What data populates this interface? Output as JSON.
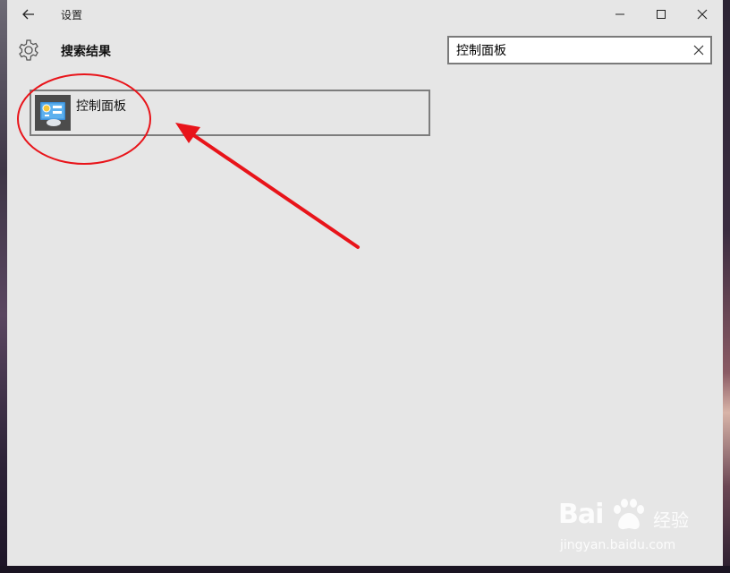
{
  "window": {
    "title": "设置",
    "back_icon": "back-arrow-icon",
    "minimize_icon": "minimize-icon",
    "maximize_icon": "maximize-icon",
    "close_icon": "close-icon"
  },
  "header": {
    "icon": "gear-icon",
    "title": "搜索结果"
  },
  "search": {
    "value": "控制面板",
    "clear_icon": "clear-x-icon"
  },
  "results": [
    {
      "label": "控制面板",
      "icon": "control-panel-icon"
    }
  ],
  "annotations": {
    "color": "#e8141a",
    "circle": "highlight-circle",
    "arrow": "pointer-arrow"
  },
  "watermark": {
    "brand": "Bai",
    "brand_suffix": "经验",
    "url": "jingyan.baidu.com"
  }
}
